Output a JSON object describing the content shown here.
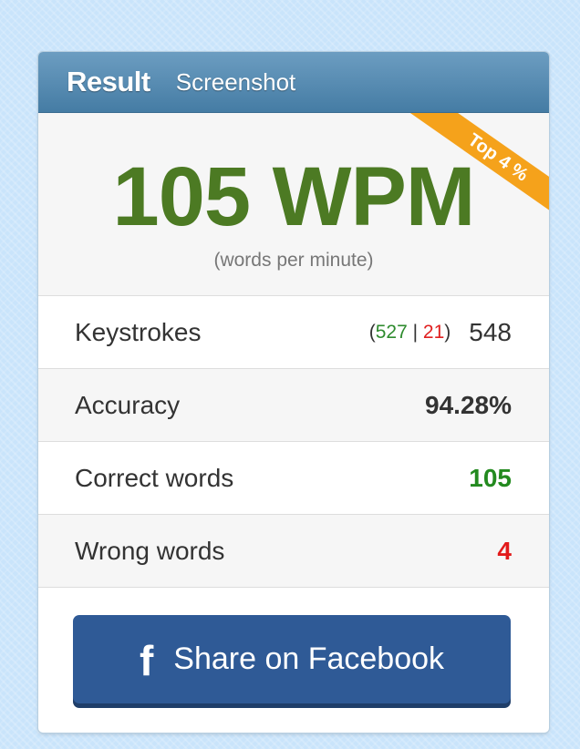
{
  "tabs": {
    "result": "Result",
    "screenshot": "Screenshot"
  },
  "hero": {
    "wpm": "105 WPM",
    "subtitle": "(words per minute)",
    "rank_badge": "Top 4 %"
  },
  "stats": {
    "keystrokes": {
      "label": "Keystrokes",
      "correct": "527",
      "wrong": "21",
      "total": "548"
    },
    "accuracy": {
      "label": "Accuracy",
      "value": "94.28%"
    },
    "correct_words": {
      "label": "Correct words",
      "value": "105"
    },
    "wrong_words": {
      "label": "Wrong words",
      "value": "4"
    }
  },
  "share": {
    "label": "Share on Facebook",
    "icon": "facebook-icon"
  },
  "colors": {
    "wpm": "#4c7a23",
    "badge": "#f5a21b",
    "header": "#457ca4",
    "facebook": "#2f5a96",
    "correct": "#238a1f",
    "wrong": "#e21b1b"
  }
}
